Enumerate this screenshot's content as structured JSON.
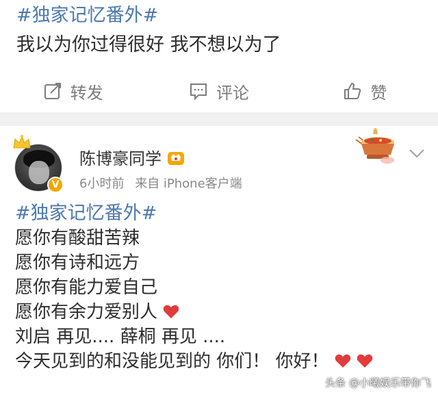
{
  "top_post": {
    "hashtag": "#独家记忆番外#",
    "text": "我以为你过得很好  我不想以为了"
  },
  "actions": [
    {
      "label": "转发",
      "icon": "share-icon"
    },
    {
      "label": "评论",
      "icon": "comment-icon"
    },
    {
      "label": "赞",
      "icon": "like-icon"
    }
  ],
  "main_post": {
    "username": "陈博豪同学",
    "time": "6小时前",
    "source": "来自 iPhone客户端",
    "hashtag": "#独家记忆番外#",
    "lines": [
      "愿你有酸甜苦辣",
      "愿你有诗和远方",
      "愿你有能力爱自己",
      "愿你有余力爱别人",
      "刘启 再见.... 薛桐 再见 ....",
      "今天见到的和没能见到的 你们！ 你好！"
    ],
    "badge": "V"
  },
  "watermark": "头条 @小曦娱乐带你飞",
  "colors": {
    "hashtag": "#4b78b0",
    "heart": "#e33b3b",
    "badge": "#f5a600"
  }
}
